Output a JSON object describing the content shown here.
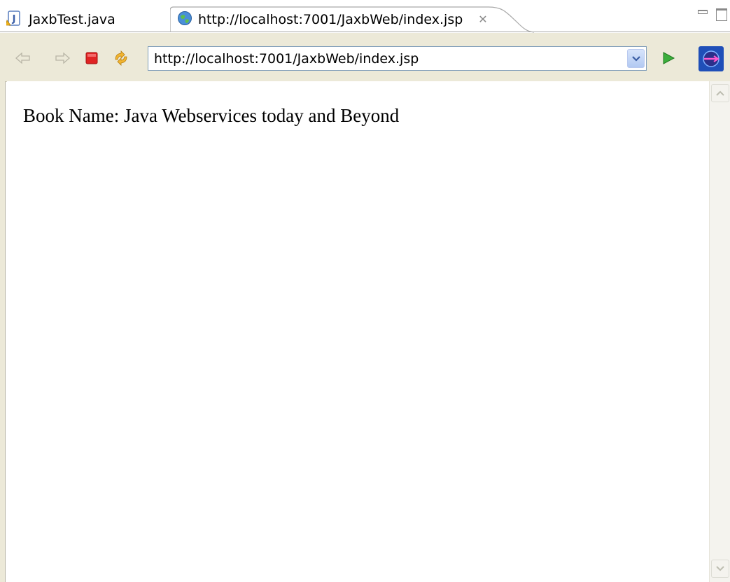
{
  "tabs": [
    {
      "label": "JaxbTest.java",
      "icon": "java-file-icon",
      "active": false
    },
    {
      "label": "http://localhost:7001/JaxbWeb/index.jsp",
      "icon": "globe-icon",
      "active": true,
      "close_glyph": "✕"
    }
  ],
  "toolbar": {
    "back_icon": "back-arrow-icon",
    "forward_icon": "forward-arrow-icon",
    "stop_icon": "stop-icon",
    "refresh_icon": "refresh-icon",
    "url": "http://localhost:7001/JaxbWeb/index.jsp",
    "go_icon": "go-arrow-icon",
    "extra_icon": "browser-logo-icon"
  },
  "page": {
    "book_line": "Book Name: Java Webservices today and Beyond"
  },
  "colors": {
    "toolbar_bg": "#ece9d8",
    "url_border": "#7f9db9",
    "stop_red": "#e02424",
    "go_green": "#3cae3c"
  }
}
